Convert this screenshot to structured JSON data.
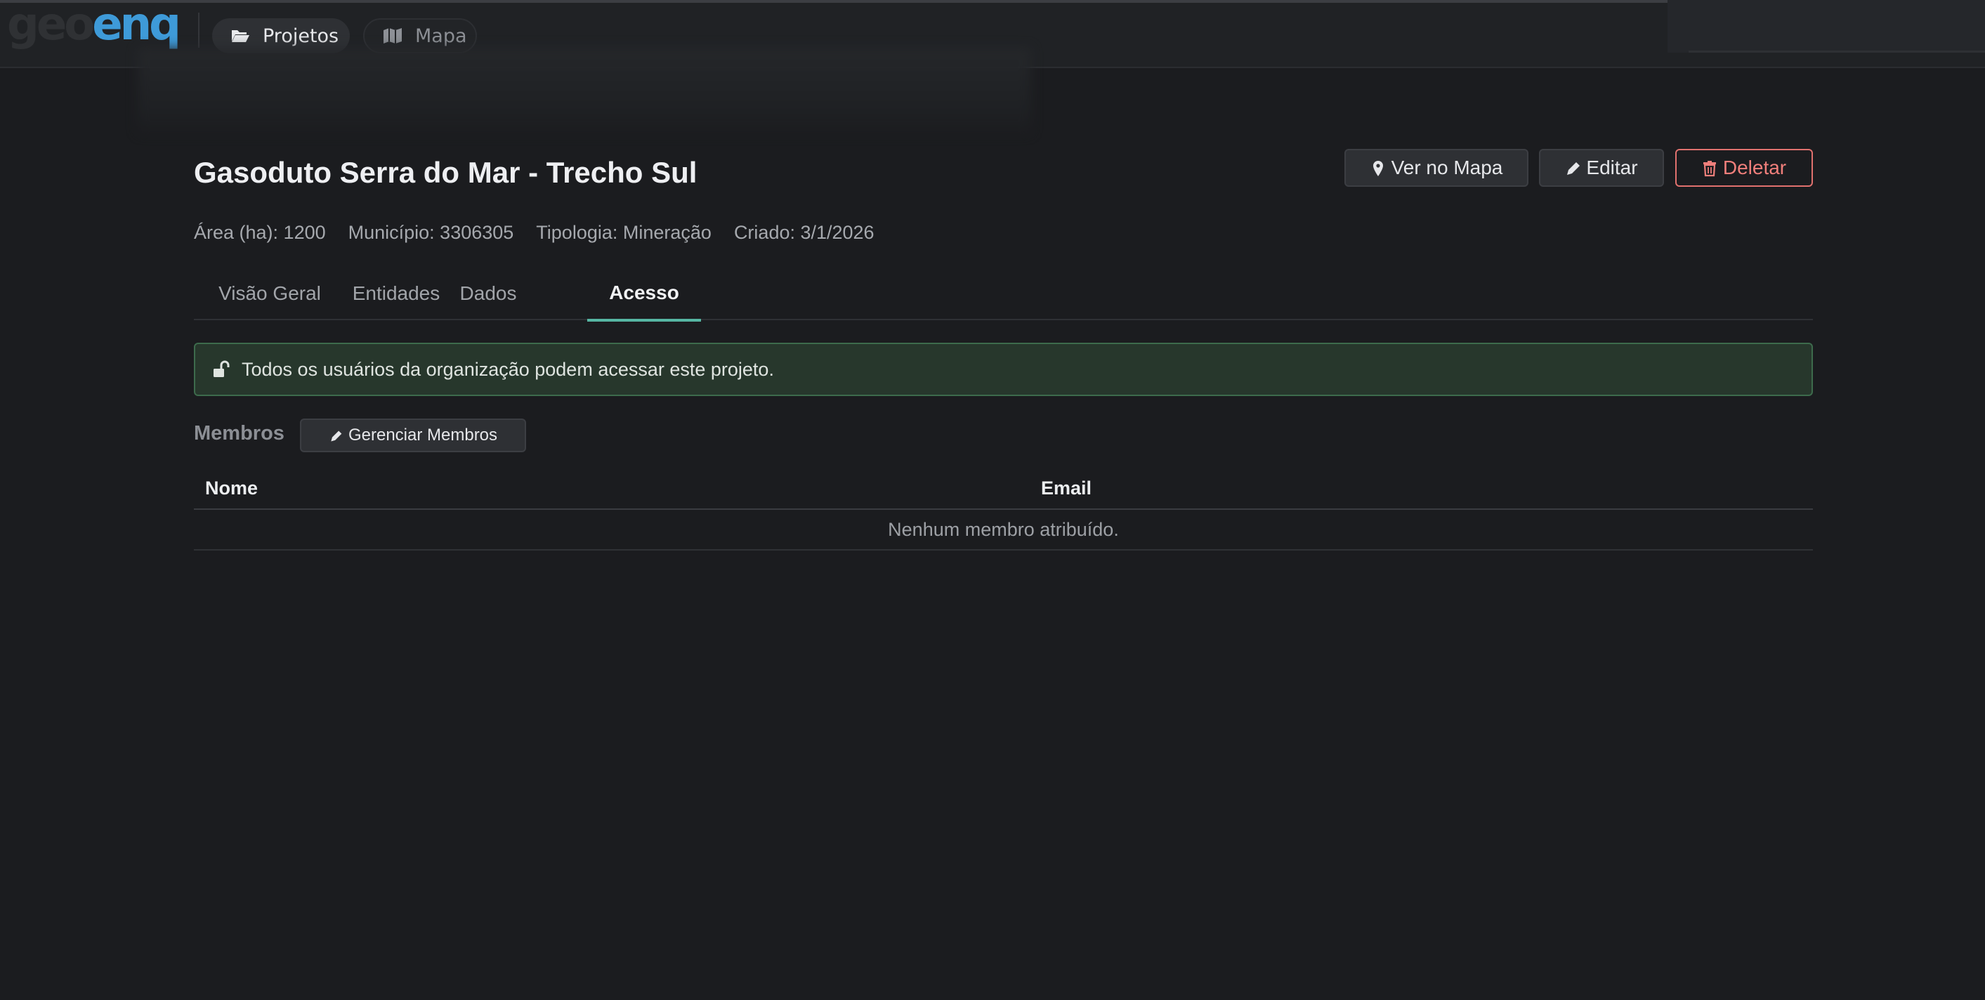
{
  "app": {
    "logo_part_a": "geo",
    "logo_part_b": "enq"
  },
  "nav": {
    "items": [
      {
        "label": "Projetos",
        "icon": "folder-open-icon",
        "active": true
      },
      {
        "label": "Mapa",
        "icon": "map-icon",
        "active": false
      }
    ]
  },
  "project": {
    "title": "Gasoduto Serra do Mar - Trecho Sul",
    "meta": {
      "area": "Área (ha): 1200",
      "municipio": "Município: 3306305",
      "tipologia": "Tipologia: Mineração",
      "criado": "Criado: 3/1/2026"
    }
  },
  "actions": {
    "map_label": "Ver no Mapa",
    "edit_label": "Editar",
    "delete_label": "Deletar"
  },
  "tabs": [
    {
      "label": "Visão Geral",
      "active": false
    },
    {
      "label": "Entidades",
      "active": false
    },
    {
      "label": "Dados",
      "active": false
    },
    {
      "label": "Acesso",
      "active": true
    }
  ],
  "access": {
    "alert_text": "Todos os usuários da organização podem acessar este projeto.",
    "members_label": "Membros",
    "manage_members_label": "Gerenciar Membros",
    "table": {
      "columns": [
        "Nome",
        "Email"
      ],
      "empty_text": "Nenhum membro atribuído."
    }
  },
  "colors": {
    "background": "#1b1c1f",
    "accent_tab": "#56b6a3",
    "brand_blue": "#3e9ad8",
    "danger": "#e0716e",
    "success_bg": "#27372c",
    "success_border": "#3d6b4c"
  }
}
